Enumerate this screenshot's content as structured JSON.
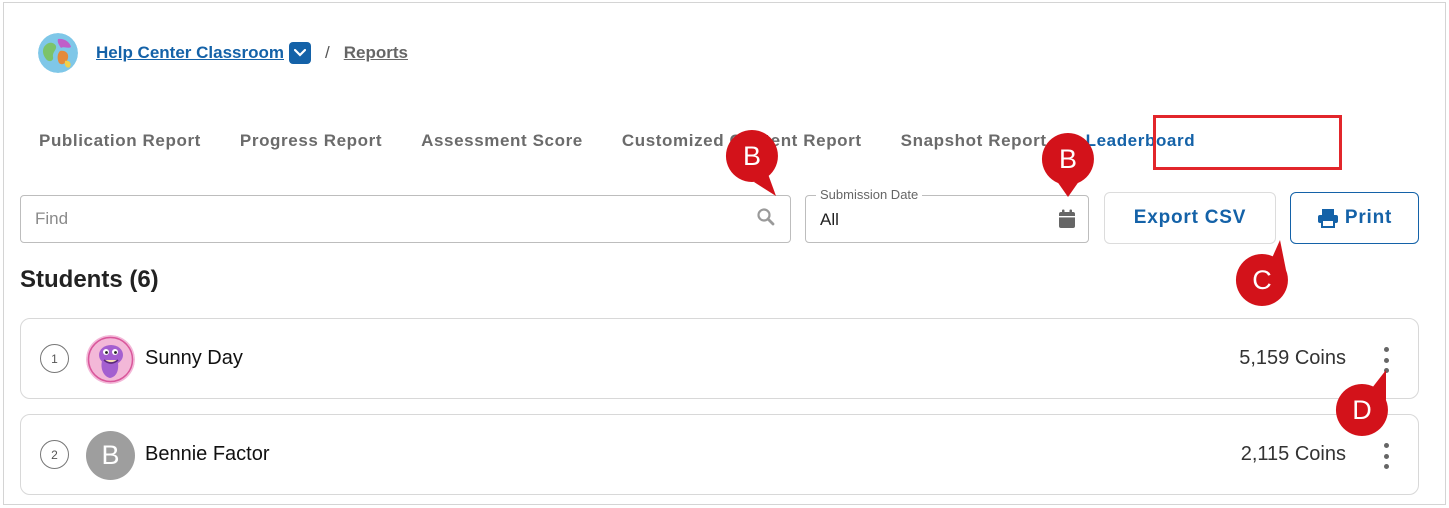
{
  "breadcrumb": {
    "classroom": "Help Center Classroom",
    "separator": "/",
    "current": "Reports"
  },
  "tabs": [
    {
      "label": "Publication Report"
    },
    {
      "label": "Progress Report"
    },
    {
      "label": "Assessment Score"
    },
    {
      "label": "Customized Content Report"
    },
    {
      "label": "Snapshot Report"
    },
    {
      "label": "Leaderboard",
      "active": true
    }
  ],
  "filters": {
    "find_placeholder": "Find",
    "date_label": "Submission Date",
    "date_value": "All"
  },
  "buttons": {
    "export": "Export CSV",
    "print": "Print"
  },
  "students": {
    "heading": "Students (6)",
    "rows": [
      {
        "rank": "1",
        "name": "Sunny Day",
        "coins": "5,159 Coins"
      },
      {
        "rank": "2",
        "initial": "B",
        "name": "Bennie Factor",
        "coins": "2,115 Coins"
      }
    ]
  },
  "markers": [
    "B",
    "B",
    "C",
    "D"
  ],
  "colors": {
    "brand_blue": "#1462a8",
    "highlight_red": "#e2262b",
    "marker_red": "#d3121a"
  }
}
